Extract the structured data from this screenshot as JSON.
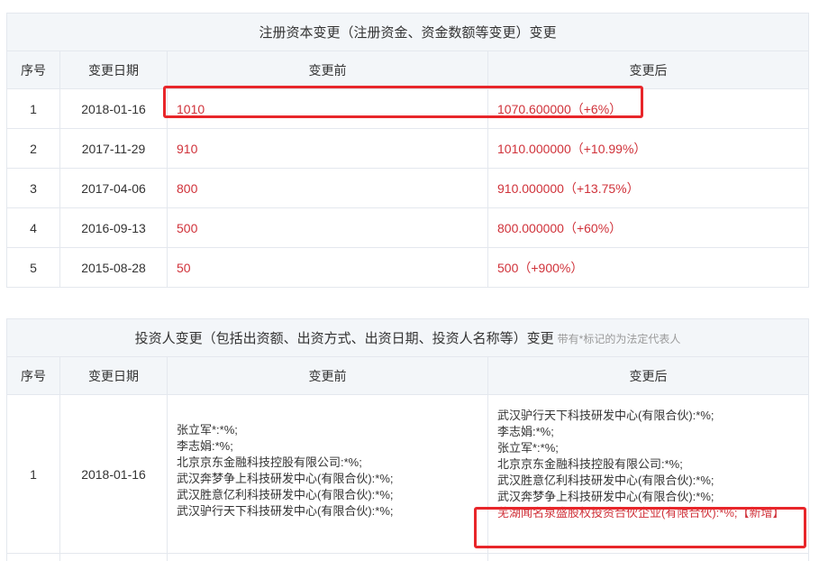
{
  "capital_section": {
    "title": "注册资本变更（注册资金、资金数额等变更）变更",
    "headers": {
      "no": "序号",
      "date": "变更日期",
      "before": "变更前",
      "after": "变更后"
    },
    "rows": [
      {
        "no": "1",
        "date": "2018-01-16",
        "before": "1010",
        "after": "1070.600000（+6%）"
      },
      {
        "no": "2",
        "date": "2017-11-29",
        "before": "910",
        "after": "1010.000000（+10.99%）"
      },
      {
        "no": "3",
        "date": "2017-04-06",
        "before": "800",
        "after": "910.000000（+13.75%）"
      },
      {
        "no": "4",
        "date": "2016-09-13",
        "before": "500",
        "after": "800.000000（+60%）"
      },
      {
        "no": "5",
        "date": "2015-08-28",
        "before": "50",
        "after": "500（+900%）"
      }
    ]
  },
  "investor_section": {
    "title": "投资人变更（包括出资额、出资方式、出资日期、投资人名称等）变更",
    "note": "带有*标记的为法定代表人",
    "headers": {
      "no": "序号",
      "date": "变更日期",
      "before": "变更前",
      "after": "变更后"
    },
    "row": {
      "no": "1",
      "date": "2018-01-16",
      "before": [
        "张立军*:*%;",
        "李志娟:*%;",
        "北京京东金融科技控股有限公司:*%;",
        "武汉奔梦争上科技研发中心(有限合伙):*%;",
        "武汉胜意亿利科技研发中心(有限合伙):*%;",
        "武汉驴行天下科技研发中心(有限合伙):*%;"
      ],
      "after": [
        "武汉驴行天下科技研发中心(有限合伙):*%;",
        "李志娟:*%;",
        "张立军*:*%;",
        "北京京东金融科技控股有限公司:*%;",
        "武汉胜意亿利科技研发中心(有限合伙):*%;",
        "武汉奔梦争上科技研发中心(有限合伙):*%;"
      ],
      "after_new": "芜湖闻名泉盛股权投资合伙企业(有限合伙):*%;【新增】"
    }
  },
  "colors": {
    "highlight_red": "#d0323a",
    "annotation_red": "#e8262a",
    "header_bg": "#f3f6f9",
    "border": "#e4e8ee"
  }
}
